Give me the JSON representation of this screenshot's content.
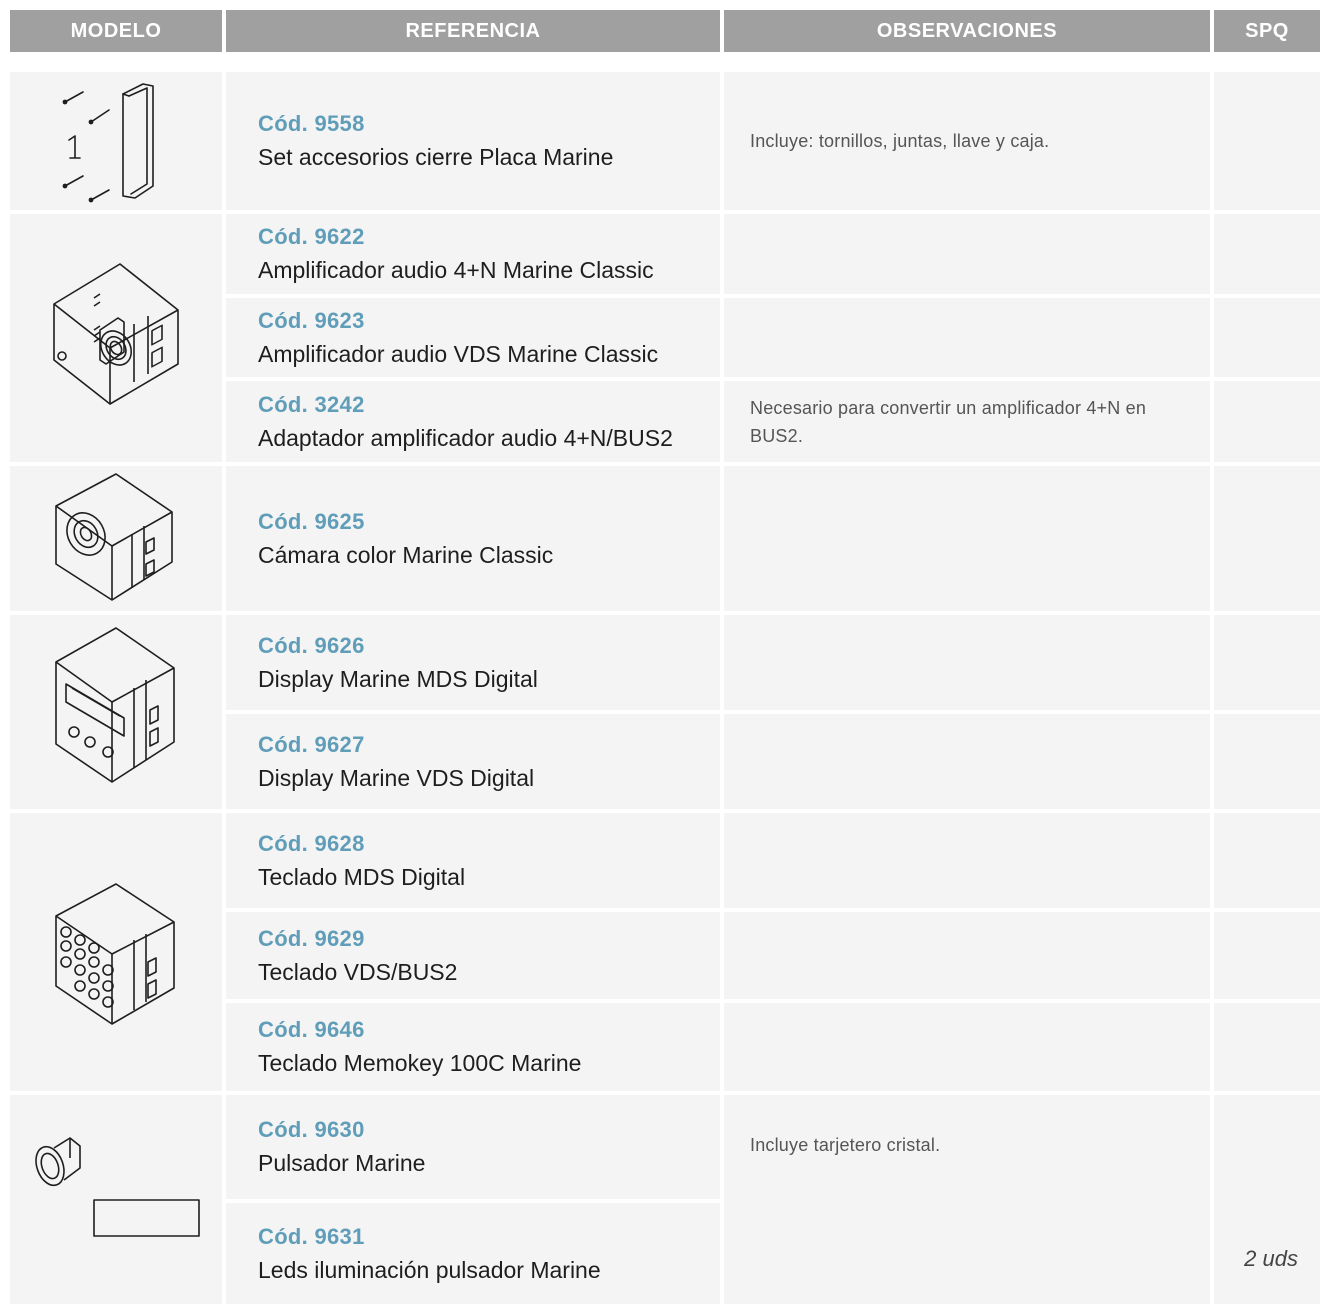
{
  "headers": {
    "modelo": "MODELO",
    "referencia": "REFERENCIA",
    "observaciones": "OBSERVACIONES",
    "spq": "SPQ"
  },
  "rows": [
    {
      "code": "Cód. 9558",
      "name": "Set accesorios cierre Placa Marine",
      "obs": "Incluye: tornillos, juntas, llave y caja.",
      "spq": ""
    },
    {
      "code": "Cód. 9622",
      "name": "Amplificador audio 4+N Marine Classic",
      "obs": "",
      "spq": ""
    },
    {
      "code": "Cód. 9623",
      "name": "Amplificador audio VDS Marine Classic",
      "obs": "",
      "spq": ""
    },
    {
      "code": "Cód. 3242",
      "name": "Adaptador amplificador audio 4+N/BUS2",
      "obs": "Necesario para convertir un amplificador 4+N en BUS2.",
      "spq": ""
    },
    {
      "code": "Cód. 9625",
      "name": "Cámara color Marine Classic",
      "obs": "",
      "spq": ""
    },
    {
      "code": "Cód. 9626",
      "name": "Display Marine MDS Digital",
      "obs": "",
      "spq": ""
    },
    {
      "code": "Cód. 9627",
      "name": "Display Marine VDS Digital",
      "obs": "",
      "spq": ""
    },
    {
      "code": "Cód. 9628",
      "name": "Teclado MDS Digital",
      "obs": "",
      "spq": ""
    },
    {
      "code": "Cód. 9629",
      "name": "Teclado VDS/BUS2",
      "obs": "",
      "spq": ""
    },
    {
      "code": "Cód. 9646",
      "name": "Teclado Memokey 100C Marine",
      "obs": "",
      "spq": ""
    },
    {
      "code": "Cód. 9630",
      "name": "Pulsador Marine",
      "obs": "Incluye tarjetero cristal.",
      "spq": ""
    },
    {
      "code": "Cód. 9631",
      "name": "Leds iluminación pulsador Marine",
      "obs": "",
      "spq": "2 uds"
    }
  ],
  "product_images": [
    {
      "label": "",
      "icon": "closure-accessories-icon"
    },
    {
      "label": "",
      "icon": "audio-amplifier-icon"
    },
    {
      "label": "",
      "icon": "color-camera-icon"
    },
    {
      "label": "",
      "icon": "display-module-icon"
    },
    {
      "label": "",
      "icon": "keypad-module-icon"
    },
    {
      "label": "",
      "icon": "push-button-icon"
    }
  ]
}
